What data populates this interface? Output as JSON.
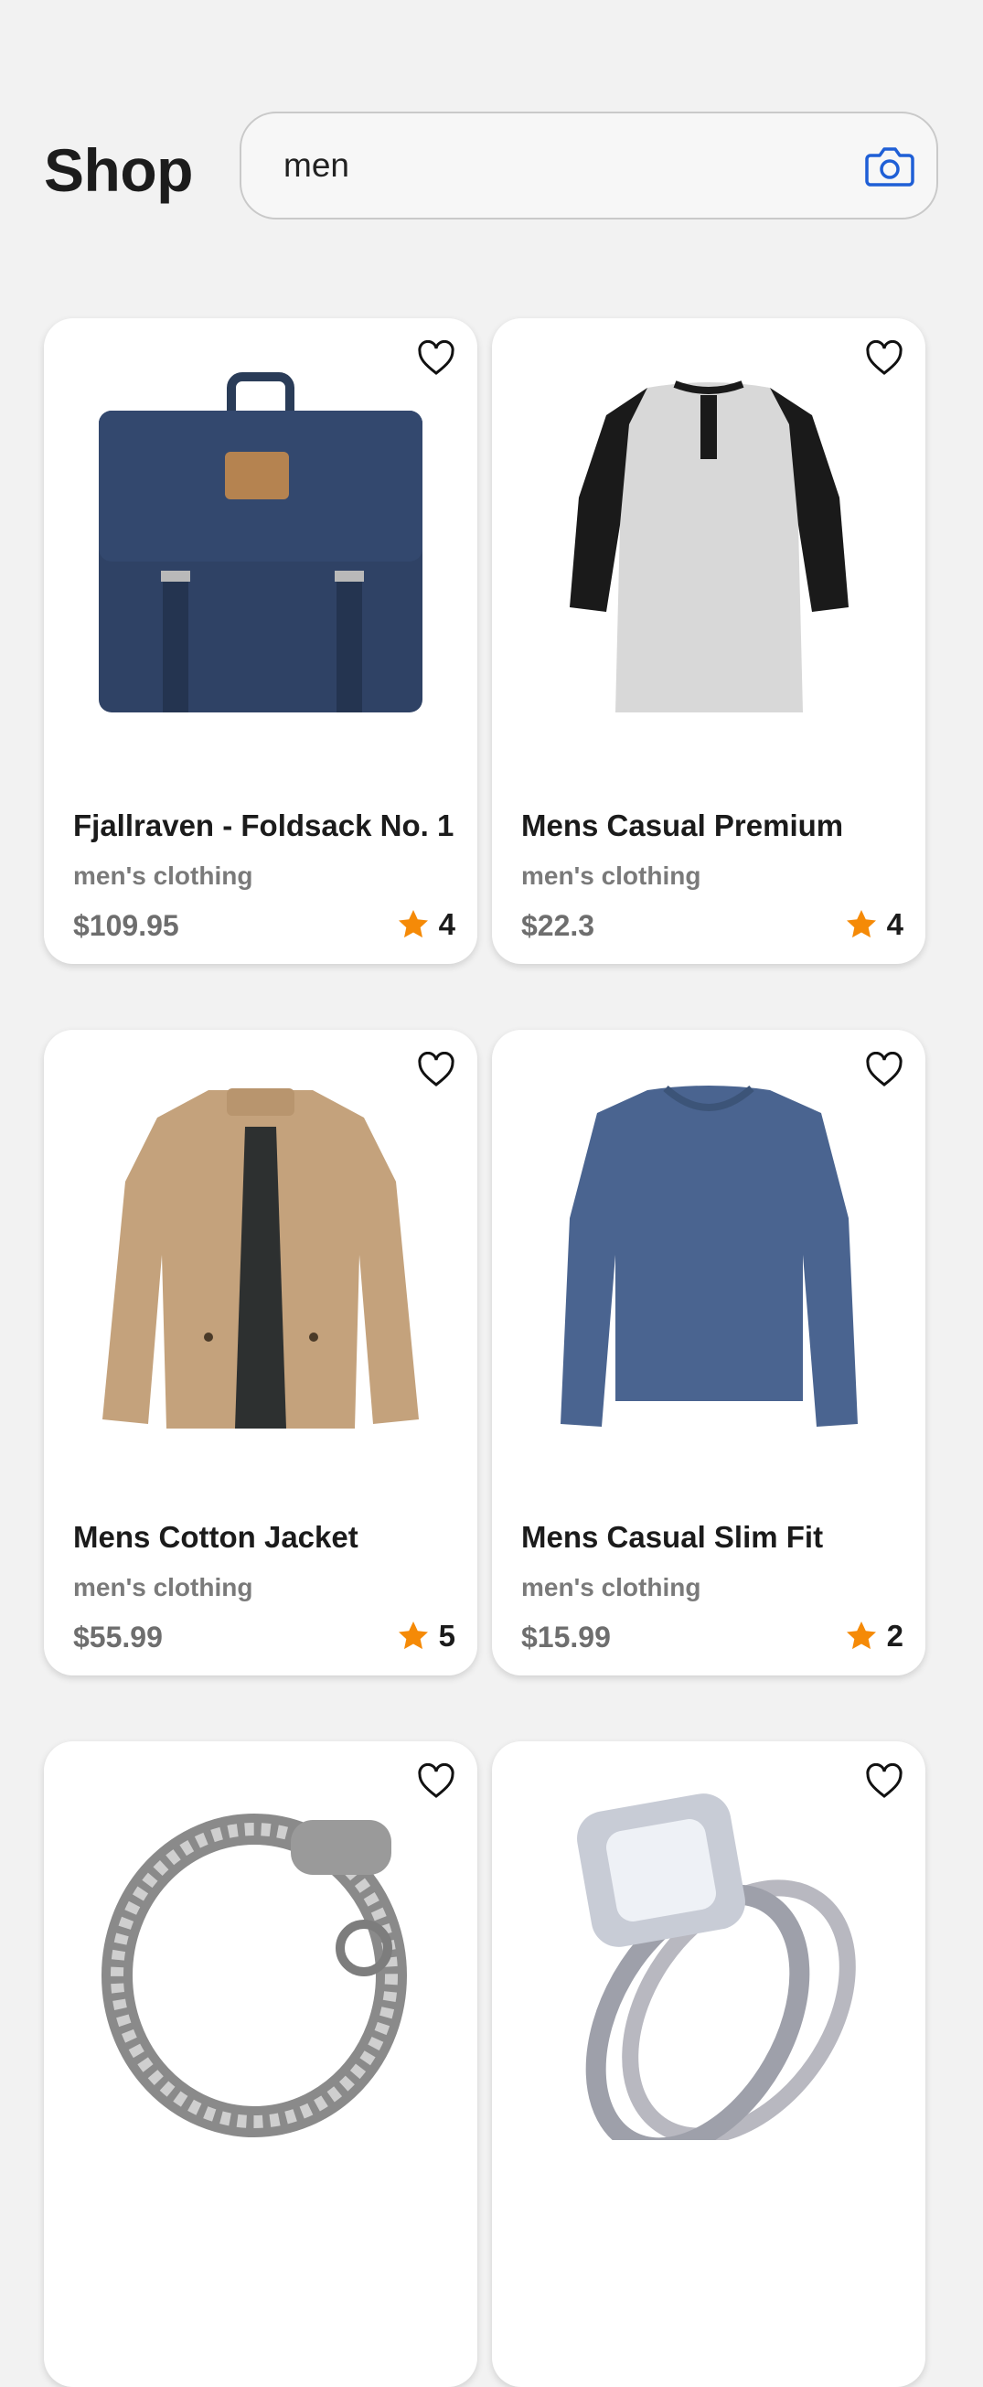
{
  "header": {
    "title": "Shop",
    "search_value": "men",
    "camera_icon": "camera-icon",
    "accent": "#1f5fd6"
  },
  "products": [
    {
      "name": "Fjallraven - Foldsack No. 1",
      "category": "men's clothing",
      "price": "$109.95",
      "rating": "4",
      "image": "backpack"
    },
    {
      "name": "Mens Casual Premium",
      "category": "men's clothing",
      "price": "$22.3",
      "rating": "4",
      "image": "raglan-shirt"
    },
    {
      "name": "Mens Cotton Jacket",
      "category": "men's clothing",
      "price": "$55.99",
      "rating": "5",
      "image": "jacket"
    },
    {
      "name": "Mens Casual Slim Fit",
      "category": "men's clothing",
      "price": "$15.99",
      "rating": "2",
      "image": "longsleeve-tee"
    },
    {
      "name": "",
      "category": "",
      "price": "",
      "rating": "",
      "image": "dragon-bracelet"
    },
    {
      "name": "",
      "category": "",
      "price": "",
      "rating": "",
      "image": "diamond-ring"
    }
  ],
  "colors": {
    "star": "#f58a07",
    "background": "#f2f2f2"
  }
}
